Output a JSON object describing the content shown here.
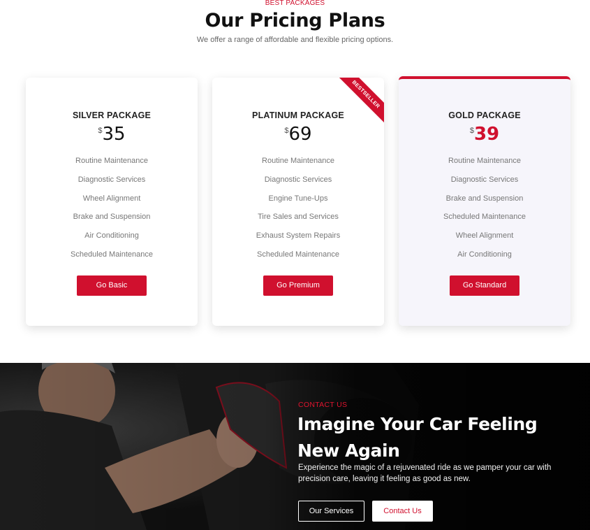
{
  "header": {
    "eyebrow": "BEST PACKAGES",
    "title": "Our Pricing Plans",
    "subtitle": "We offer a range of affordable and flexible pricing options."
  },
  "plans": [
    {
      "name": "SILVER PACKAGE",
      "currency": "$",
      "price": "35",
      "features": [
        "Routine Maintenance",
        "Diagnostic Services",
        "Wheel Alignment",
        "Brake and Suspension",
        "Air Conditioning",
        "Scheduled Maintenance"
      ],
      "button": "Go Basic"
    },
    {
      "name": "PLATINUM PACKAGE",
      "currency": "$",
      "price": "69",
      "ribbon": "BESTSELLER",
      "features": [
        "Routine Maintenance",
        "Diagnostic Services",
        "Engine Tune-Ups",
        "Tire Sales and Services",
        "Exhaust System Repairs",
        "Scheduled Maintenance"
      ],
      "button": "Go Premium"
    },
    {
      "name": "GOLD PACKAGE",
      "currency": "$",
      "price": "39",
      "features": [
        "Routine Maintenance",
        "Diagnostic Services",
        "Brake and Suspension",
        "Scheduled Maintenance",
        "Wheel Alignment",
        "Air Conditioning"
      ],
      "button": "Go Standard"
    }
  ],
  "hero": {
    "eyebrow": "CONTACT US",
    "title_line1": "Imagine Your Car Feeling",
    "title_line2": "New Again",
    "text": "Experience the magic of a rejuvenated ride as we pamper your car with precision care, leaving it feeling as good as new.",
    "buttons": {
      "services": "Our Services",
      "contact": "Contact Us"
    }
  },
  "colors": {
    "accent": "#d0102e",
    "hero_bg": "#0c0c0c",
    "gold_card_bg": "#f6f5fb"
  }
}
